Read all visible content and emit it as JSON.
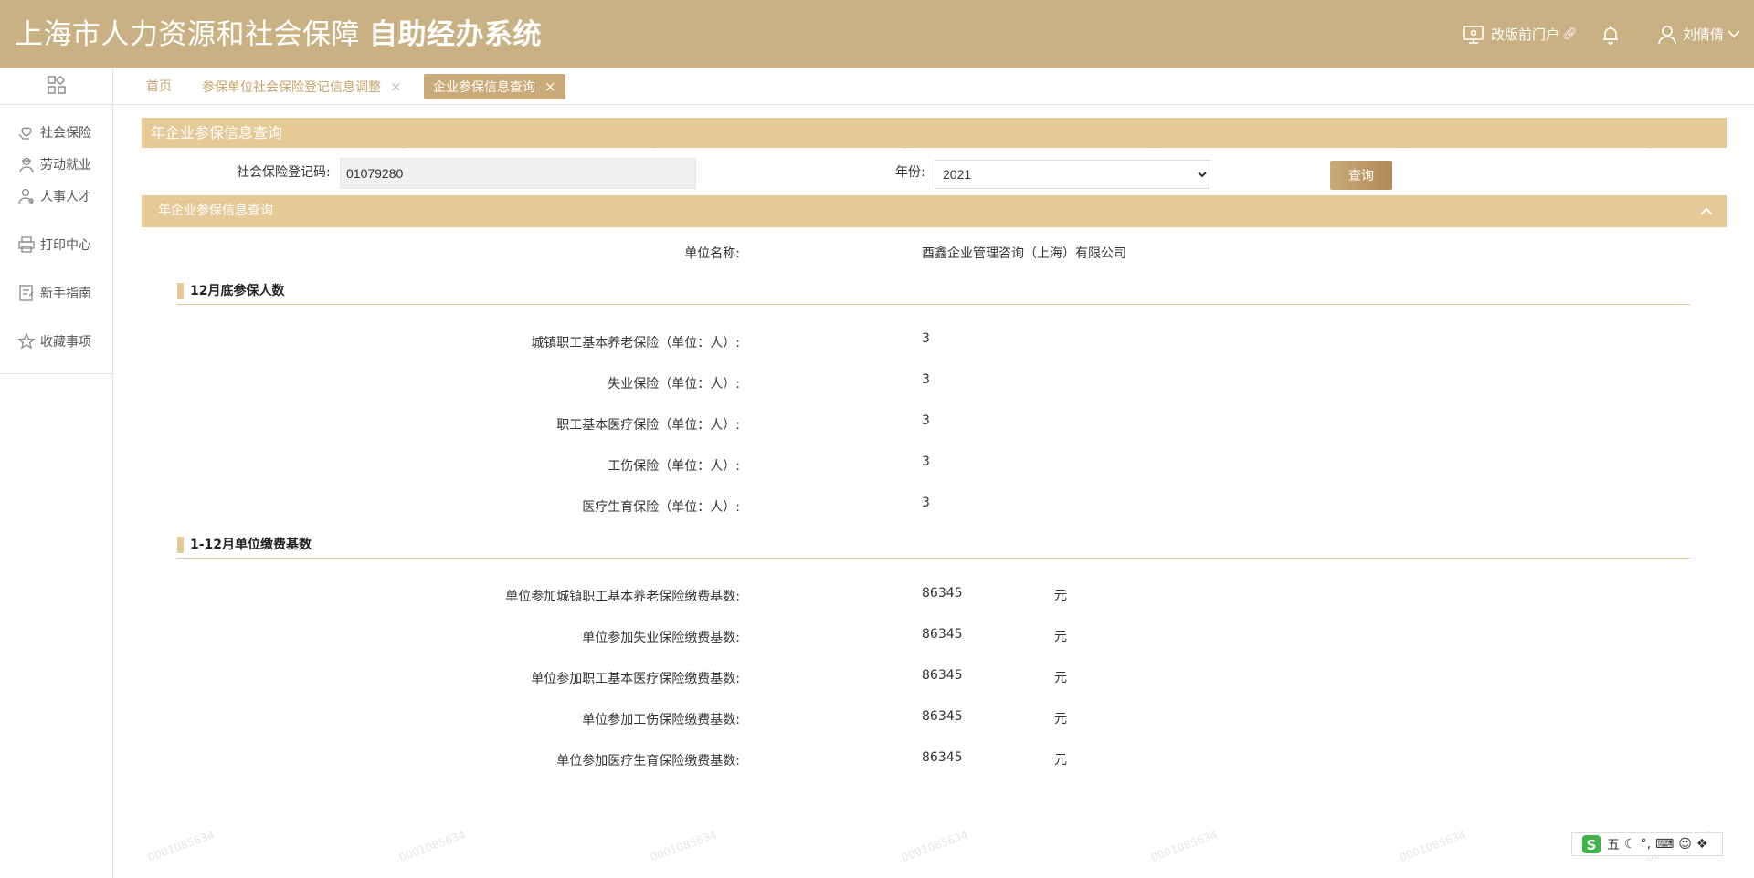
{
  "header": {
    "title_part1": "上海市人力资源和社会保障",
    "title_part2": "自助经办系统",
    "portal_label": "改版前门户",
    "user_name": "刘倩倩"
  },
  "sidebar": {
    "items": [
      {
        "label": "社会保险",
        "icon": "hands-heart-icon"
      },
      {
        "label": "劳动就业",
        "icon": "worker-icon"
      },
      {
        "label": "人事人才",
        "icon": "person-icon"
      },
      {
        "label": "打印中心",
        "icon": "printer-icon"
      },
      {
        "label": "新手指南",
        "icon": "guide-icon"
      },
      {
        "label": "收藏事项",
        "icon": "star-icon"
      }
    ]
  },
  "tabs": [
    {
      "label": "首页"
    },
    {
      "label": "参保单位社会保险登记信息调整"
    },
    {
      "label": "企业参保信息查询"
    }
  ],
  "panel": {
    "title": "年企业参保信息查询"
  },
  "form": {
    "reg_label": "社会保险登记码:",
    "reg_value": "01079280",
    "year_label": "年份:",
    "year_value": "2021",
    "query_label": "查询"
  },
  "section": {
    "title": "年企业参保信息查询",
    "unit_label": "单位名称:",
    "unit_name": "酉鑫企业管理咨询（上海）有限公司",
    "headcount_title": "12月底参保人数",
    "headcount": [
      {
        "label": "城镇职工基本养老保险（单位：人）:",
        "value": "3"
      },
      {
        "label": "失业保险（单位：人）:",
        "value": "3"
      },
      {
        "label": "职工基本医疗保险（单位：人）:",
        "value": "3"
      },
      {
        "label": "工伤保险（单位：人）:",
        "value": "3"
      },
      {
        "label": "医疗生育保险（单位：人）:",
        "value": "3"
      }
    ],
    "base_title": "1-12月单位缴费基数",
    "base": [
      {
        "label": "单位参加城镇职工基本养老保险缴费基数:",
        "value": "86345",
        "unit": "元"
      },
      {
        "label": "单位参加失业保险缴费基数:",
        "value": "86345",
        "unit": "元"
      },
      {
        "label": "单位参加职工基本医疗保险缴费基数:",
        "value": "86345",
        "unit": "元"
      },
      {
        "label": "单位参加工伤保险缴费基数:",
        "value": "86345",
        "unit": "元"
      },
      {
        "label": "单位参加医疗生育保险缴费基数:",
        "value": "86345",
        "unit": "元"
      }
    ]
  },
  "watermark": "0001085634",
  "ime": {
    "mode": "五",
    "punct": "°,"
  },
  "colors": {
    "header_bg": "#c9b183",
    "panel_bg": "#e5c997",
    "tab_active_bg": "#c9aa78",
    "tab_text": "#c7a46a"
  }
}
